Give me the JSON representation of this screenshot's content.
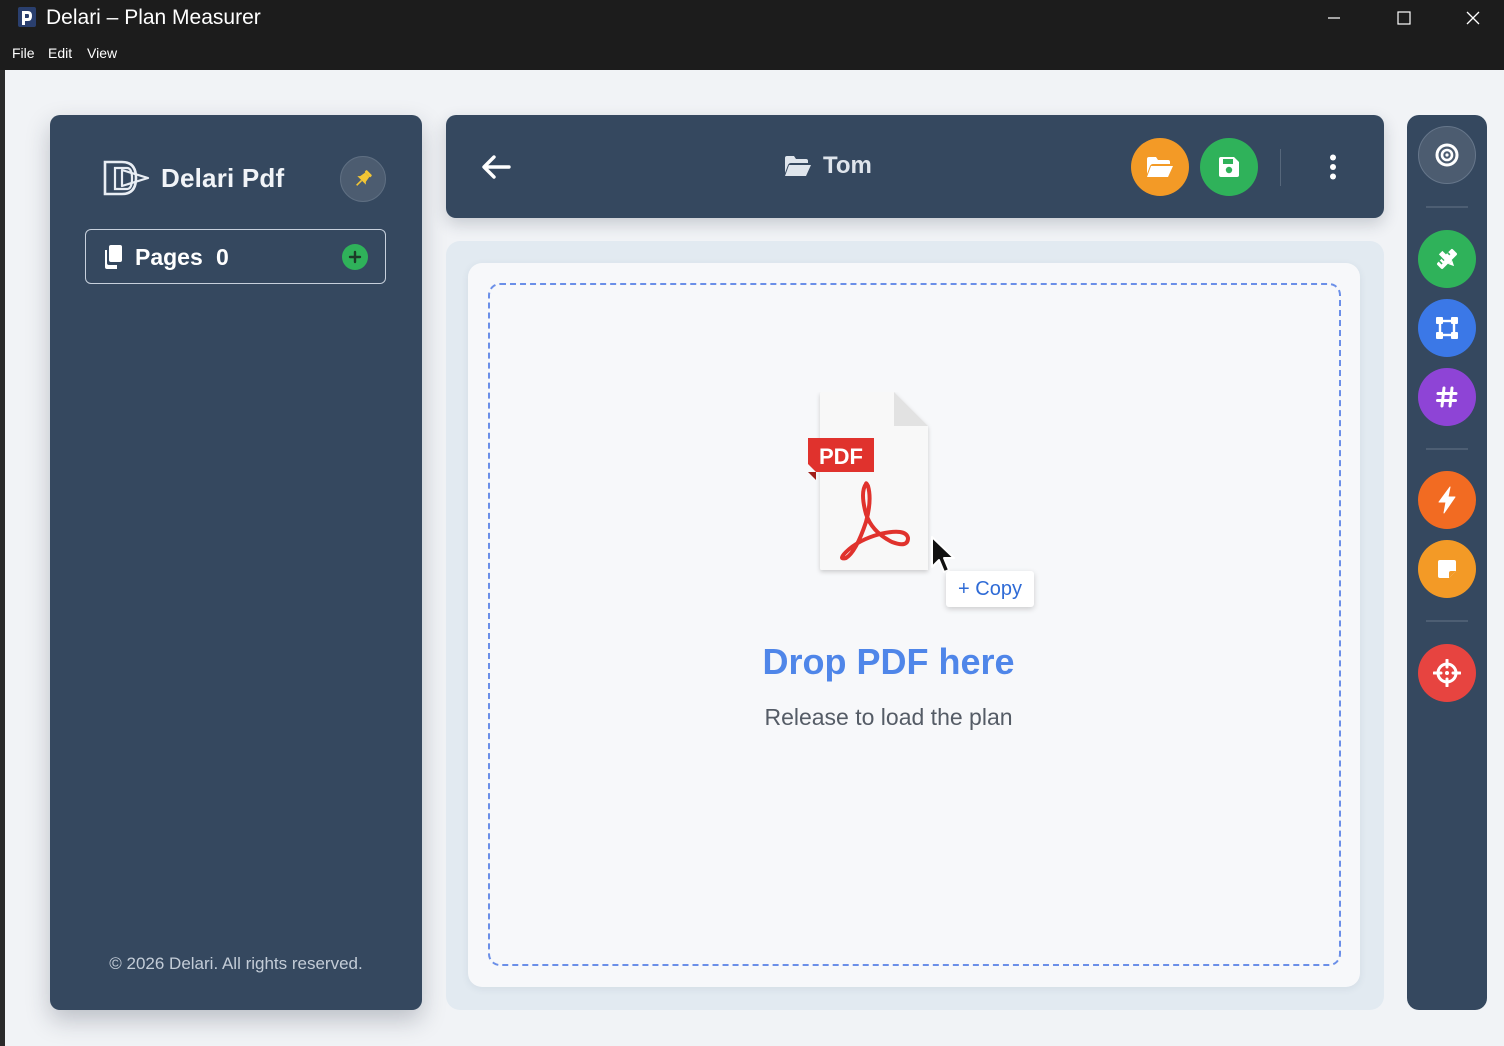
{
  "window": {
    "title": "Delari – Plan Measurer",
    "menu": [
      "File",
      "Edit",
      "View"
    ]
  },
  "sidebar": {
    "brand": "Delari Pdf",
    "pages_label": "Pages",
    "pages_count": "0",
    "copyright": "© 2026 Delari. All rights reserved."
  },
  "header": {
    "project_name": "Tom"
  },
  "dropzone": {
    "badge": "PDF",
    "copy_tooltip": "+ Copy",
    "title": "Drop PDF here",
    "subtitle": "Release to load the plan"
  },
  "toolbar": {
    "tools": [
      {
        "icon": "target-icon",
        "color": "#4c5c70"
      },
      {
        "icon": "ruler-pencil-icon",
        "color": "#2fb25a"
      },
      {
        "icon": "vector-square-icon",
        "color": "#3b78e7"
      },
      {
        "icon": "hashtag-icon",
        "color": "#8e44d6"
      },
      {
        "icon": "bolt-icon",
        "color": "#f26b22"
      },
      {
        "icon": "note-icon",
        "color": "#f39a26"
      },
      {
        "icon": "crosshairs-icon",
        "color": "#e74440"
      }
    ]
  },
  "colors": {
    "panel": "#35485f",
    "accent_blue": "#4f86e9",
    "open_button": "#f39a26",
    "save_button": "#2fb25a"
  }
}
